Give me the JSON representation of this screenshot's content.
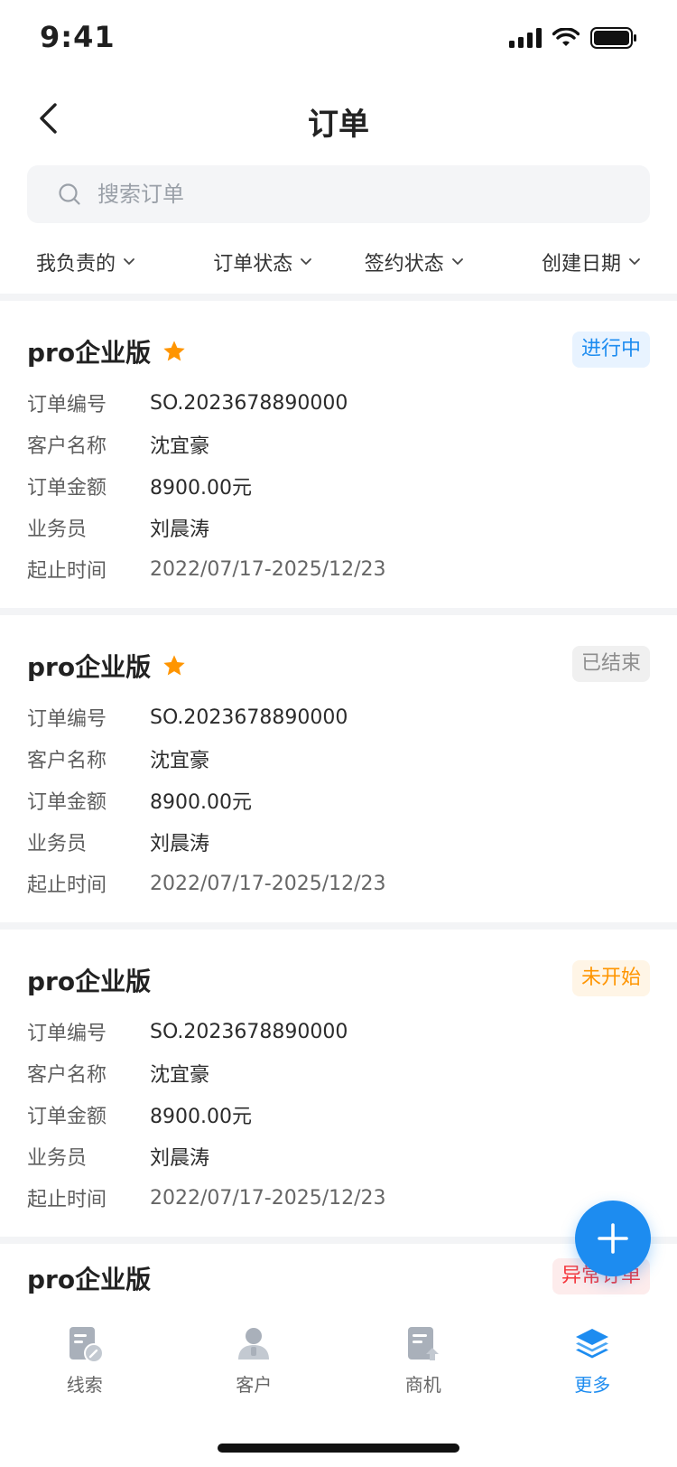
{
  "status_bar": {
    "time": "9:41"
  },
  "nav": {
    "title": "订单"
  },
  "search": {
    "placeholder": "搜索订单"
  },
  "filters": [
    {
      "label": "我负责的"
    },
    {
      "label": "订单状态"
    },
    {
      "label": "签约状态"
    },
    {
      "label": "创建日期"
    }
  ],
  "row_labels": {
    "order_no": "订单编号",
    "customer": "客户名称",
    "amount": "订单金额",
    "sales": "业务员",
    "period": "起止时间"
  },
  "orders": [
    {
      "title": "pro企业版",
      "starred": true,
      "status": "进行中",
      "order_no": "SO.2023678890000",
      "customer": "沈宜豪",
      "amount": "8900.00元",
      "sales": "刘晨涛",
      "period": "2022/07/17-2025/12/23"
    },
    {
      "title": "pro企业版",
      "starred": true,
      "status": "已结束",
      "order_no": "SO.2023678890000",
      "customer": "沈宜豪",
      "amount": "8900.00元",
      "sales": "刘晨涛",
      "period": "2022/07/17-2025/12/23"
    },
    {
      "title": "pro企业版",
      "starred": false,
      "status": "未开始",
      "order_no": "SO.2023678890000",
      "customer": "沈宜豪",
      "amount": "8900.00元",
      "sales": "刘晨涛",
      "period": "2022/07/17-2025/12/23"
    },
    {
      "title": "pro企业版",
      "starred": false,
      "status": "异常订单"
    }
  ],
  "tabs": [
    {
      "label": "线索",
      "icon": "clue-icon",
      "active": false
    },
    {
      "label": "客户",
      "icon": "customer-icon",
      "active": false
    },
    {
      "label": "商机",
      "icon": "opportunity-icon",
      "active": false
    },
    {
      "label": "更多",
      "icon": "layers-icon",
      "active": true
    }
  ],
  "colors": {
    "accent": "#1d8cf0",
    "star": "#ff9500",
    "status_running": "#1d8cf0",
    "status_ended": "#8e8e8e",
    "status_not_started": "#ff9500",
    "status_abnormal": "#f5363c"
  }
}
